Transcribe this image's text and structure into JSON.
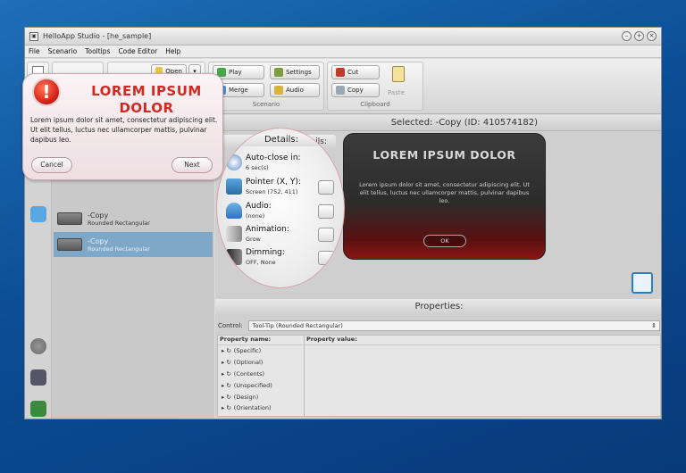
{
  "window": {
    "title": "HelloApp Studio - [he_sample]"
  },
  "menu": [
    "File",
    "Scenario",
    "Tooltips",
    "Code Editor",
    "Help"
  ],
  "ribbon": {
    "open": "Open",
    "play": "Play",
    "settings": "Settings",
    "merge": "Merge",
    "audio": "Audio",
    "scenario_label": "Scenario",
    "cut": "Cut",
    "copy": "Copy",
    "paste": "Paste",
    "clipboard_label": "Clipboard"
  },
  "list": [
    {
      "title": "-Copy",
      "subtitle": "Rounded Rectangular",
      "selected": false
    },
    {
      "title": "-Copy",
      "subtitle": "Rounded Rectangular",
      "selected": true
    }
  ],
  "main": {
    "selected_text": "Selected: -Copy (ID: 410574182)",
    "details_header": "Details:",
    "preview": {
      "title": "LOREM IPSUM DOLOR",
      "body": "Lorem ipsum dolor sit amet, consectetur adipiscing elit. Ut elit tellus, luctus nec ullamcorper mattis, pulvinar dapibus leo.",
      "ok": "OK"
    },
    "properties_header": "Properties:",
    "control_label": "Control:",
    "control_value": "Tool-Tip (Rounded Rectangular)",
    "prop_name_header": "Property name:",
    "prop_value_header": "Property value:",
    "prop_rows": [
      "(Specific)",
      "(Optional)",
      "(Contents)",
      "(Unspecified)",
      "(Design)",
      "(Orientation)"
    ]
  },
  "details": {
    "autoclose_label": "Auto-close in:",
    "autoclose_value": "6 sec(s)",
    "pointer_label": "Pointer (X, Y):",
    "pointer_value": "Screen (752, 411)",
    "audio_label": "Audio:",
    "audio_value": "(none)",
    "animation_label": "Animation:",
    "animation_value": "Grow",
    "dimming_label": "Dimming:",
    "dimming_value": "OFF, None"
  },
  "callout": {
    "title": "LOREM IPSUM DOLOR",
    "body": "Lorem ipsum dolor sit amet, consectetur adipiscing elit. Ut elit tellus, luctus nec ullamcorper mattis, pulvinar dapibus leo.",
    "cancel": "Cancel",
    "next": "Next"
  },
  "colors": {
    "accent_red": "#d12a24",
    "selection": "#7fa7c8",
    "desktop": "#0b4d96"
  }
}
